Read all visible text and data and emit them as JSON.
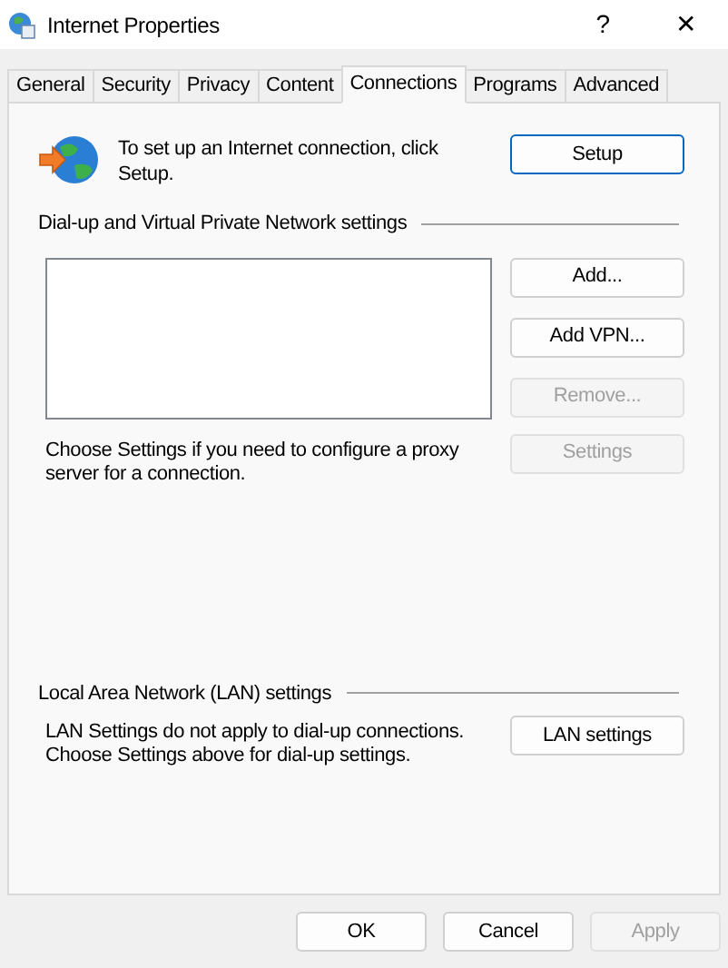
{
  "window": {
    "title": "Internet Properties",
    "help": "?",
    "close": "✕"
  },
  "tabs": [
    {
      "label": "General",
      "selected": false
    },
    {
      "label": "Security",
      "selected": false
    },
    {
      "label": "Privacy",
      "selected": false
    },
    {
      "label": "Content",
      "selected": false
    },
    {
      "label": "Connections",
      "selected": true
    },
    {
      "label": "Programs",
      "selected": false
    },
    {
      "label": "Advanced",
      "selected": false
    }
  ],
  "setup": {
    "text": "To set up an Internet connection, click Setup.",
    "button": {
      "label": "Setup",
      "default": true,
      "disabled": false
    }
  },
  "dialup": {
    "heading": "Dial-up and Virtual Private Network settings",
    "buttons": [
      {
        "label": "Add...",
        "disabled": false
      },
      {
        "label": "Add VPN...",
        "disabled": false
      },
      {
        "label": "Remove...",
        "disabled": true
      }
    ],
    "proxy_text": "Choose Settings if you need to configure a proxy server for a connection.",
    "settings_button": {
      "label": "Settings",
      "disabled": true
    }
  },
  "lan": {
    "heading": "Local Area Network (LAN) settings",
    "text": "LAN Settings do not apply to dial-up connections. Choose Settings above for dial-up settings.",
    "button": {
      "label": "LAN settings",
      "disabled": false
    }
  },
  "footer_buttons": [
    {
      "label": "OK",
      "disabled": false
    },
    {
      "label": "Cancel",
      "disabled": false
    },
    {
      "label": "Apply",
      "disabled": true
    }
  ]
}
